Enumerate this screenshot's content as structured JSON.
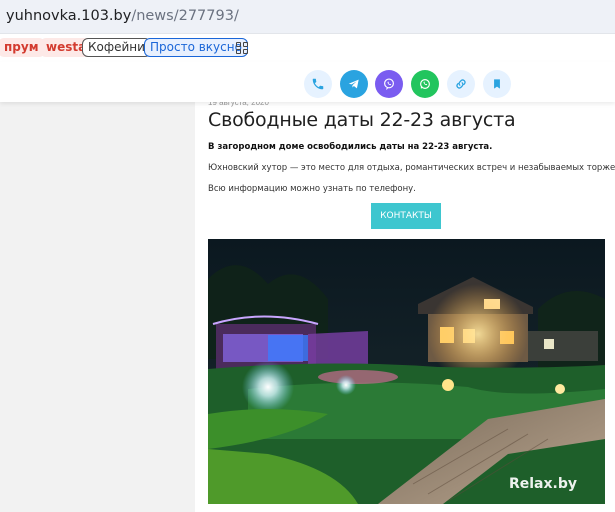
{
  "browser": {
    "url_host": "yuhnovka.103.by",
    "url_path": "/news/277793/"
  },
  "bookmarks": [
    {
      "label": "прум"
    },
    {
      "label": "westa"
    },
    {
      "label": "Кофейни"
    },
    {
      "label": "Просто вкусно"
    }
  ],
  "share": {
    "icons": [
      "phone-icon",
      "telegram-icon",
      "viber-icon",
      "whatsapp-icon",
      "link-icon",
      "bookmark-icon"
    ],
    "colors": [
      "#e6f2ff",
      "#2aa3e0",
      "#7a5cf0",
      "#22c55e",
      "#e6f2ff",
      "#e6f2ff"
    ]
  },
  "article": {
    "date": "19 августа, 2020",
    "title": "Свободные даты 22-23 августа",
    "lead": "В загородном доме освободились даты на 22-23 августа.",
    "paragraph_1": "Юхновский хутор — это место для отдыха, романтических встреч и незабываемых торжеств.",
    "paragraph_2": "Всю информацию можно узнать по телефону.",
    "contact_button": "КОНТАКТЫ",
    "photo_watermark": "Relax.by"
  },
  "colors": {
    "accent": "#3ec6cf",
    "url_bar_bg": "#eef1f7",
    "left_panel_bg": "#f2f2f2"
  }
}
